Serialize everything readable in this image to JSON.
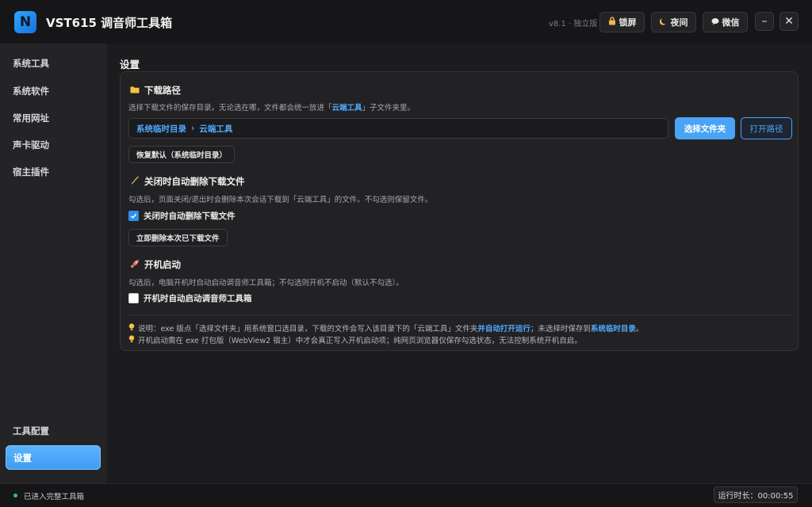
{
  "app": {
    "logo_letter": "N",
    "title": "VST615 调音师工具箱",
    "version": "v8.1 · 独立版"
  },
  "toolbar": {
    "lock_label": "锁屏",
    "night_label": "夜间",
    "wechat_label": "微信",
    "minimize_glyph": "–",
    "close_glyph": "✕"
  },
  "sidebar": {
    "items": [
      {
        "label": "系统工具"
      },
      {
        "label": "系统软件"
      },
      {
        "label": "常用网址"
      },
      {
        "label": "声卡驱动"
      },
      {
        "label": "宿主插件"
      }
    ],
    "bottom_items": [
      {
        "label": "工具配置"
      },
      {
        "label": "设置"
      }
    ],
    "active": "设置"
  },
  "main": {
    "page_title": "设置",
    "download": {
      "title": "下载路径",
      "desc_pre": "选择下载文件的保存目录。无论选在哪，文件都会统一放进「",
      "desc_link": "云端工具",
      "desc_post": "」子文件夹里。",
      "path_part1": "系统临时目录",
      "path_sep": "›",
      "path_part2": "云端工具",
      "choose_button": "选择文件夹",
      "open_button": "打开路径",
      "reset_button": "恢复默认（系统临时目录）"
    },
    "auto_delete": {
      "title": "关闭时自动删除下载文件",
      "desc": "勾选后，页面关闭/退出时会删除本次会话下载到「云端工具」的文件。不勾选则保留文件。",
      "checkbox_label": "关闭时自动删除下载文件",
      "checked": true,
      "delete_now_button": "立即删除本次已下载文件"
    },
    "startup": {
      "title": "开机启动",
      "desc": "勾选后，电脑开机时自动启动调音师工具箱；不勾选则开机不启动（默认不勾选）。",
      "checkbox_label": "开机时自动启动调音师工具箱",
      "checked": false
    },
    "notes": {
      "note1_pre": "说明：exe 版点「选择文件夹」用系统窗口选目录，下载的文件会写入该目录下的「云端工具」文件夹",
      "note1_link1": "并自动打开运行",
      "note1_mid": "；未选择时保存到",
      "note1_link2": "系统临时目录",
      "note1_post": "。",
      "note2": "开机启动需在 exe 打包版（WebView2 宿主）中才会真正写入开机启动项；纯网页浏览器仅保存勾选状态，无法控制系统开机自启。"
    }
  },
  "status": {
    "text": "已进入完整工具箱",
    "runtime": "运行时长：00:00:55"
  },
  "colors": {
    "accent": "#4aa3f5",
    "status_ok": "#33c27a"
  },
  "icons": [
    "lock-icon",
    "moon-icon",
    "chat-icon",
    "folder-icon",
    "broom-icon",
    "rocket-icon",
    "bulb-icon"
  ]
}
